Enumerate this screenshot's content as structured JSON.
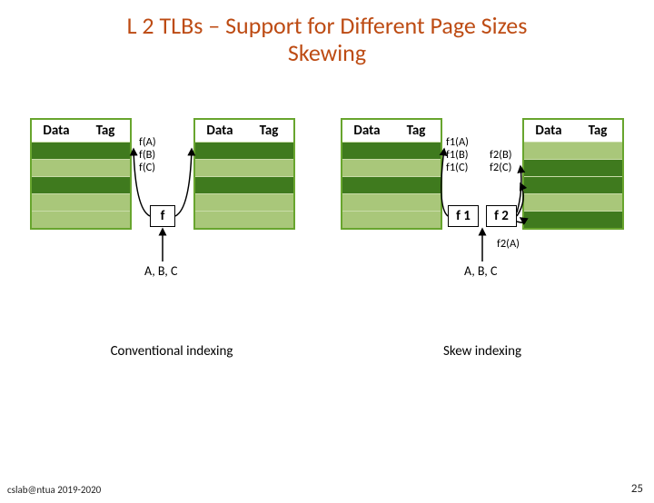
{
  "title_line1": "L 2 TLBs – Support for Different Page Sizes",
  "title_line2": "Skewing",
  "headers": {
    "data": "Data",
    "tag": "Tag"
  },
  "conv": {
    "fbox": "f",
    "flabels": [
      "f(A)",
      "f(B)",
      "f(C)"
    ],
    "input": "A, B, C",
    "caption": "Conventional indexing"
  },
  "skew": {
    "f1box": "f 1",
    "f2box": "f 2",
    "f1labels": [
      "f1(A)",
      "f1(B)",
      "f1(C)"
    ],
    "f2labels_top": [
      "f2(B)",
      "f2(C)"
    ],
    "f2label_bottom": "f2(A)",
    "input": "A, B, C",
    "caption": "Skew indexing"
  },
  "footer": {
    "left": "cslab@ntua 2019-2020",
    "page": "25"
  }
}
